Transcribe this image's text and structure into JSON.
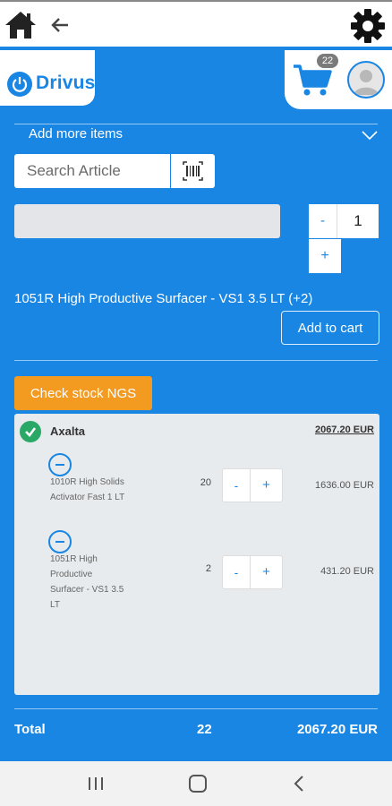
{
  "header": {
    "logo_text": "Drivus",
    "cart_count": "22"
  },
  "add_more": {
    "label": "Add more items"
  },
  "search": {
    "placeholder": "Search Article"
  },
  "quantity": {
    "minus": "-",
    "value": "1",
    "plus": "+"
  },
  "product": {
    "title": "1051R High Productive Surfacer - VS1 3.5 LT (+2)",
    "add_to_cart": "Add to cart"
  },
  "check_stock": {
    "label": "Check stock NGS"
  },
  "supplier": {
    "name": "Axalta",
    "total": "2067.20 EUR",
    "items": [
      {
        "name": "1010R High Solids Activator Fast 1 LT",
        "qty": "20",
        "minus": "-",
        "plus": "+",
        "price": "1636.00 EUR"
      },
      {
        "name": "1051R High Productive Surfacer - VS1 3.5 LT",
        "qty": "2",
        "minus": "-",
        "plus": "+",
        "price": "431.20 EUR"
      }
    ]
  },
  "total": {
    "label": "Total",
    "qty": "22",
    "sum": "2067.20 EUR"
  },
  "colors": {
    "primary": "#1a86e4",
    "accent": "#f39a21",
    "success": "#2aa866"
  }
}
